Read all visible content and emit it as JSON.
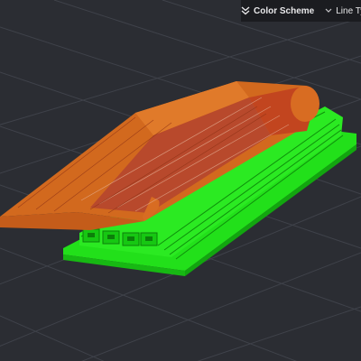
{
  "toolbar": {
    "color_scheme_label": "Color Scheme",
    "line_type_label": "Line Type"
  },
  "icons": {
    "collapse": "double-chevron-down-icon",
    "dropdown": "chevron-down-icon"
  },
  "colors": {
    "background": "#2b2d33",
    "grid": "#3f424a",
    "model_shell": "#d2691e",
    "model_inner": "#b5482c",
    "support": "#22e01a",
    "support_dark": "#0fa80c",
    "toolbar_bg": "#1b1c20"
  }
}
